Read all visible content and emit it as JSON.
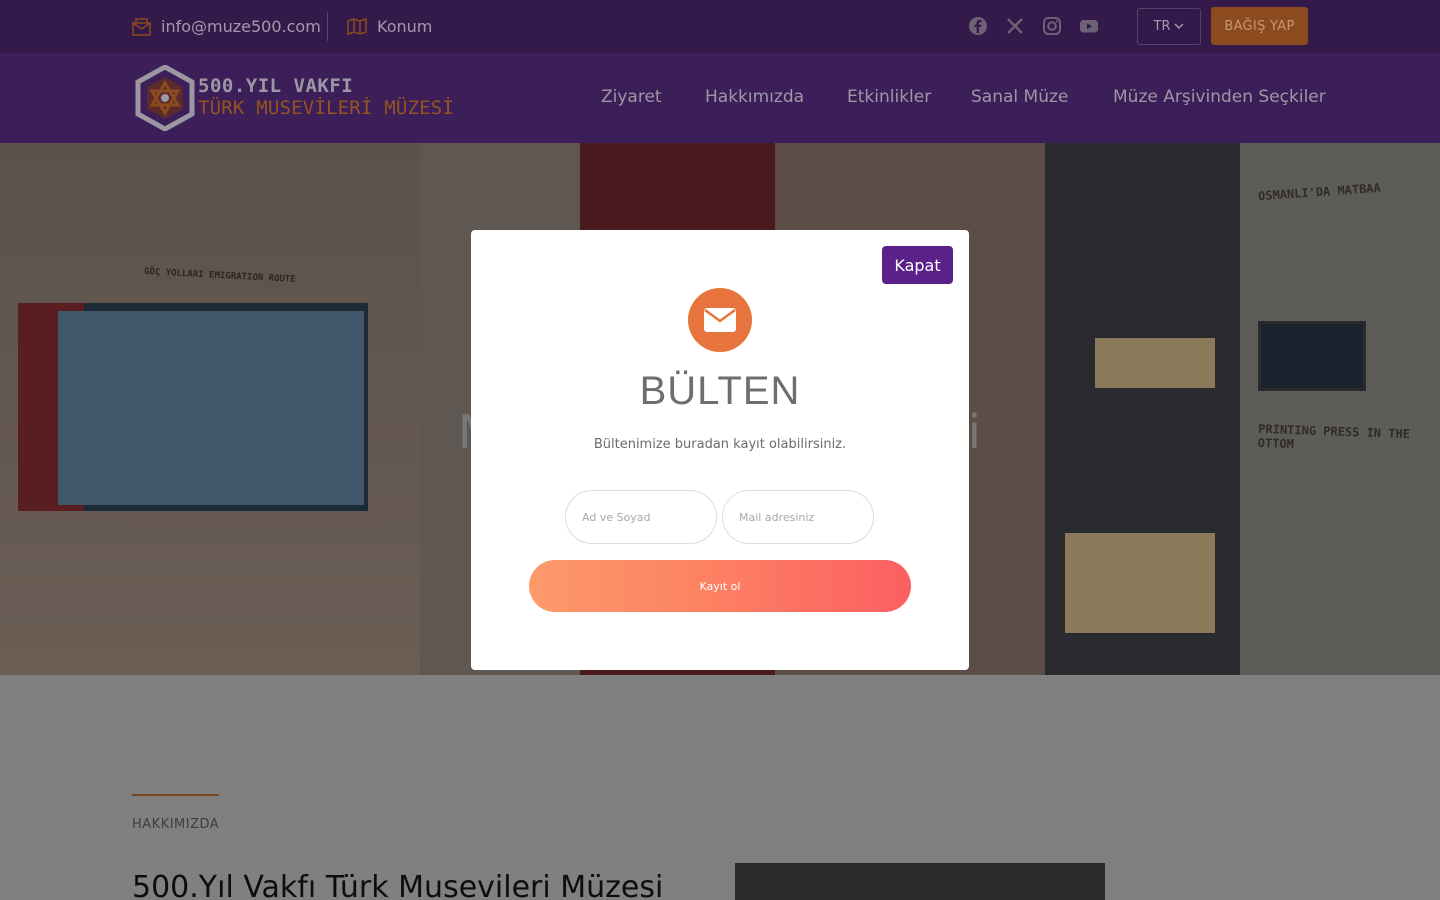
{
  "topbar": {
    "email": "info@muze500.com",
    "location": "Konum",
    "social_icons": [
      "facebook-icon",
      "x-icon",
      "instagram-icon",
      "youtube-icon"
    ],
    "language": "TR",
    "donate_label": "BAĞIŞ YAP"
  },
  "logo": {
    "line1": "500.YIL VAKFI",
    "line2": "TÜRK MUSEVİLERİ MÜZESİ"
  },
  "nav": {
    "items": [
      {
        "label": "Ziyaret"
      },
      {
        "label": "Hakkımızda"
      },
      {
        "label": "Etkinlikler"
      },
      {
        "label": "Sanal Müze"
      },
      {
        "label": "Müze Arşivinden Seçkiler"
      }
    ]
  },
  "hero": {
    "map_heading": "GÖÇ YOLLARI EMIGRATION ROUTE",
    "right_heading": "OSMANLI'DA MATBAA",
    "right_heading2": "PRINTING PRESS IN THE OTTOM"
  },
  "about": {
    "eyebrow": "HAKKIMIZDA",
    "title": "500.Yıl Vakfı Türk Musevileri Müzesi"
  },
  "modal": {
    "close_label": "Kapat",
    "title": "BÜLTEN",
    "subtitle": "Bültenimize buradan kayıt olabilirsiniz.",
    "name_placeholder": "Ad ve Soyad",
    "email_placeholder": "Mail adresiniz",
    "submit_label": "Kayıt ol"
  },
  "colors": {
    "topbar_bg": "#331a4a",
    "nav_bg": "#3c1f58",
    "accent_orange": "#e8743d",
    "close_purple": "#5b2188"
  }
}
